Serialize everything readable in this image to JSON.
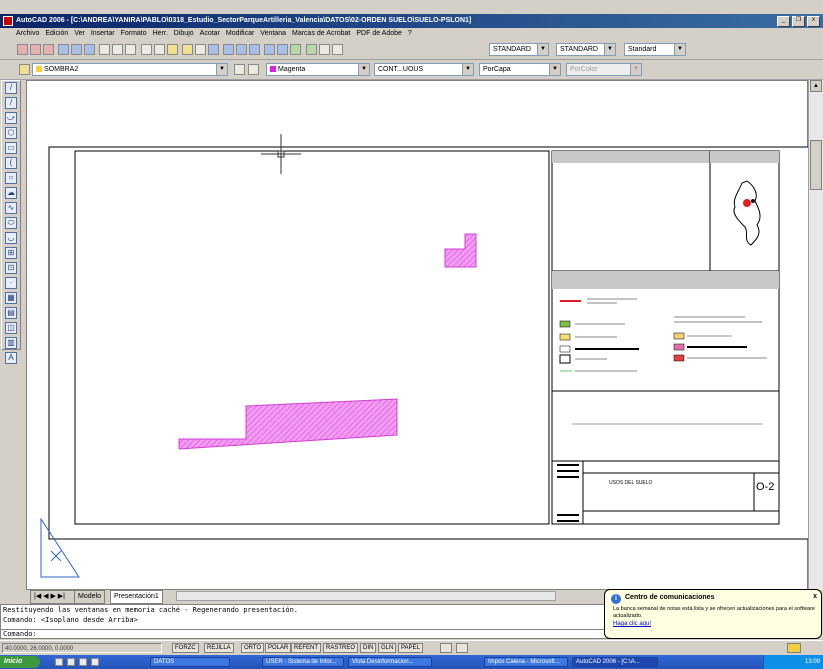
{
  "window": {
    "title": "AutoCAD 2006 - [C:\\ANDREA\\YANIRA\\PABLO\\0318_Estudio_SectorParqueArtilleria_Valencia\\DATOS\\02-ORDEN SUELO\\SUELO-PSLON1]",
    "minimize": "_",
    "restore": "❐",
    "close": "x"
  },
  "menu": [
    "Archivo",
    "Edición",
    "Ver",
    "Insertar",
    "Formato",
    "Herr.",
    "Dibujo",
    "Acotar",
    "Modificar",
    "Ventana",
    "Marcas de Acrobat",
    "PDF de Adobe",
    "?"
  ],
  "toolbar": {
    "text_style": "STANDARD",
    "dim_style": "STANDARD",
    "table_style": "Standard"
  },
  "properties_bar": {
    "layer": "SOMBRA2",
    "color": "Magenta",
    "color_swatch": "#e020e0",
    "linetype": "CONT...UOUS",
    "lineweight": "PorCapa",
    "plot_style": "PorColor"
  },
  "layout_tabs": [
    "Modelo",
    "Presentación1"
  ],
  "command": {
    "history": [
      "Restituyendo las ventanas en memoria caché - Regenerando presentación.",
      "Comando:  <Isoplano desde Arriba>"
    ],
    "prompt": "Comando:"
  },
  "status": {
    "coords": "40.0000, 26.0000, 0.0000",
    "toggles": [
      "FORZC",
      "REJILLA",
      "ORTO",
      "POLAR",
      "REFENT",
      "RASTREO",
      "DIN",
      "GLN",
      "PAPEL"
    ]
  },
  "balloon": {
    "title": "Centro de comunicaciones",
    "body": "La banca semanal de notas está lista y se ofrecen actualizaciones para el software actualizado.",
    "link": "Haga clic aquí"
  },
  "drawing": {
    "sheet_number": "O-2",
    "plan_title": "USOS DEL SUELO",
    "hatch_color": "#f080f0"
  },
  "taskbar": {
    "start": "Inicio",
    "items": [
      "DATOS",
      "USER - Sistema de Infor...",
      "Vista Desinformacion...",
      "Impos Calena - Microsoft...",
      "AutoCAD 2006 - [C:\\A..."
    ],
    "clock": "13:09"
  }
}
